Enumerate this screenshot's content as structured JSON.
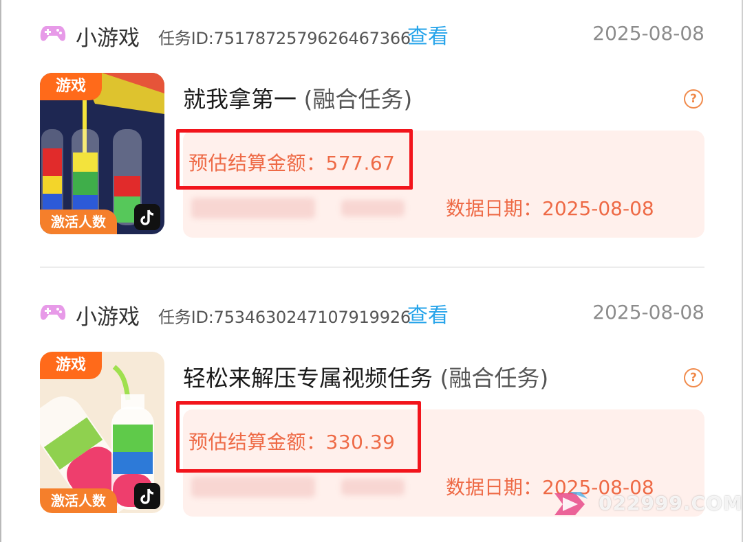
{
  "tasks": [
    {
      "category": "小游戏",
      "task_id": "任务ID:7517872579626467366",
      "view_label": "查看",
      "date": "2025-08-08",
      "tag_game": "游戏",
      "tag_active": "激活人数",
      "title_main": "就我拿第一",
      "title_sub": "(融合任务)",
      "help_icon": "?",
      "estimate": "预估结算金额：577.67",
      "data_date": "数据日期：2025-08-08"
    },
    {
      "category": "小游戏",
      "task_id": "任务ID:7534630247107919926",
      "view_label": "查看",
      "date": "2025-08-08",
      "tag_game": "游戏",
      "tag_active": "激活人数",
      "title_main": "轻松来解压专属视频任务",
      "title_sub": "(融合任务)",
      "help_icon": "?",
      "estimate": "预估结算金额：330.39",
      "data_date": "数据日期：2025-08-08"
    }
  ],
  "watermark": "022999.COM",
  "colors": {
    "link": "#27a4ea",
    "accent_orange": "#ee6a46",
    "highlight_red": "#f2141c",
    "panel_bg": "#fff0ec"
  },
  "icons": [
    "gamepad-icon",
    "help-circle-icon",
    "tiktok-icon"
  ]
}
